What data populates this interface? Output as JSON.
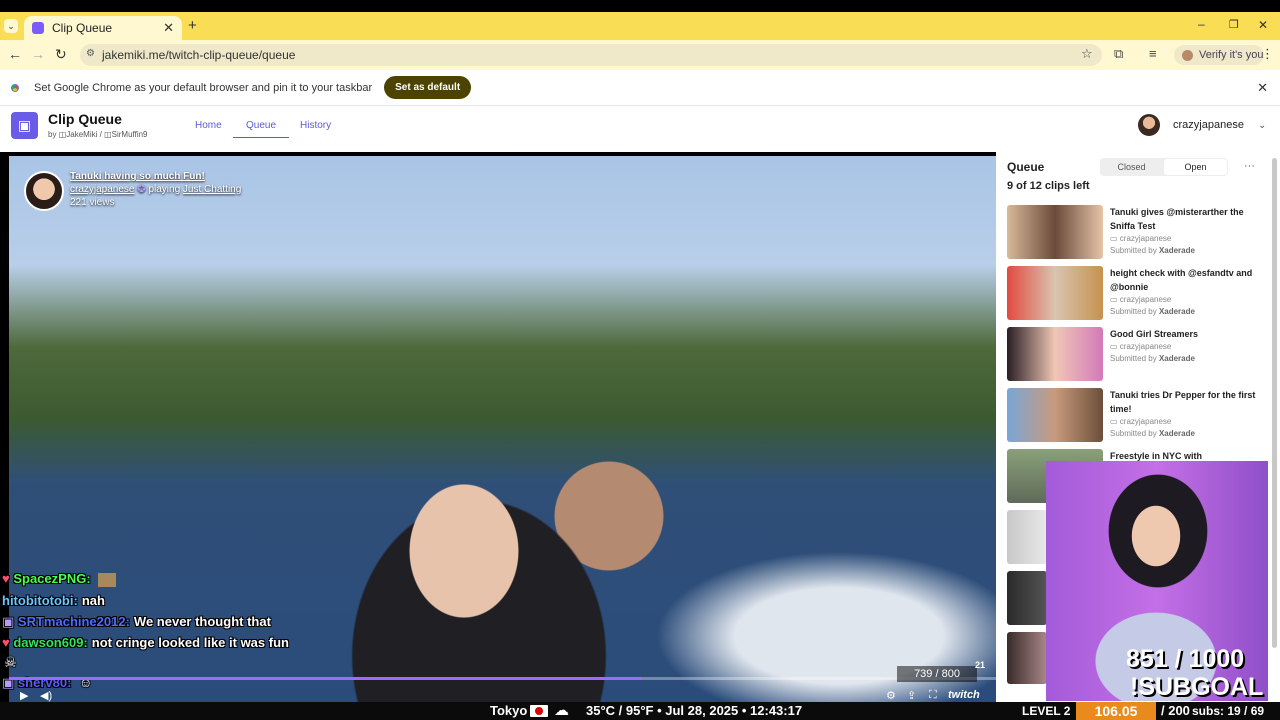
{
  "browser": {
    "tab_title": "Clip Queue",
    "new_tab": "+",
    "url": "jakemiki.me/twitch-clip-queue/queue",
    "verify": "Verify it's you",
    "window_controls": [
      "–",
      "❐",
      "✕"
    ]
  },
  "infobar": {
    "message": "Set Google Chrome as your default browser and pin it to your taskbar",
    "button": "Set as default",
    "close": "✕"
  },
  "app": {
    "title": "Clip Queue",
    "by_prefix": "by",
    "author1": "JakeMiki",
    "separator": "/",
    "author2": "SirMuffin9",
    "nav": {
      "home": "Home",
      "queue": "Queue",
      "history": "History"
    },
    "username": "crazyjapanese"
  },
  "player": {
    "clip_title": "Tanuki having so much Fun!",
    "channel": "crazyjapanese",
    "playing_word": "playing",
    "game": "Just Chatting",
    "views": "221 views",
    "progress_fraction": 0.64,
    "overlay_counter": "739  /  800",
    "overlay_small": "21",
    "brand": "twitch"
  },
  "chat": [
    {
      "name": "SpacezPNG:",
      "color": "#4cff4c",
      "text": ""
    },
    {
      "name": "hitobitotobi:",
      "color": "#6ec6ff",
      "text": "nah"
    },
    {
      "name": "SRTmachine2012:",
      "color": "#4f6bff",
      "text": "We never thought that"
    },
    {
      "name": "dawson609:",
      "color": "#32e65a",
      "text": "not cringe looked like it was fun"
    },
    {
      "name": "sherv80:",
      "color": "#5a5aff",
      "text": ""
    }
  ],
  "queue": {
    "title": "Queue",
    "count": "9 of 12 clips left",
    "closed": "Closed",
    "open": "Open",
    "more": "···",
    "items": [
      {
        "title": "Tanuki gives @misterarther the Sniffa Test",
        "channel": "crazyjapanese",
        "submitted_prefix": "Submitted by",
        "submitter": "Xaderade"
      },
      {
        "title": "height check with @esfandtv and @bonnie",
        "channel": "crazyjapanese",
        "submitted_prefix": "Submitted by",
        "submitter": "Xaderade"
      },
      {
        "title": "Good Girl Streamers",
        "channel": "crazyjapanese",
        "submitted_prefix": "Submitted by",
        "submitter": "Xaderade"
      },
      {
        "title": "Tanuki tries Dr Pepper for the first time!",
        "channel": "crazyjapanese",
        "submitted_prefix": "Submitted by",
        "submitter": "Xaderade"
      },
      {
        "title": "Freestyle in NYC with",
        "channel": "",
        "submitted_prefix": "",
        "submitter": ""
      }
    ]
  },
  "overlay": {
    "subgoal_count": "851  /  1000",
    "subgoal_label": "!SUBGOAL"
  },
  "bottombar": {
    "city": "Tokyo",
    "weather": "35°C / 95°F • Jul 28, 2025 • 12:43:17",
    "level_label": "LEVEL 2",
    "level_value": "106.05",
    "level_sep": "/ 200",
    "subs": "subs: 19 / 69"
  }
}
